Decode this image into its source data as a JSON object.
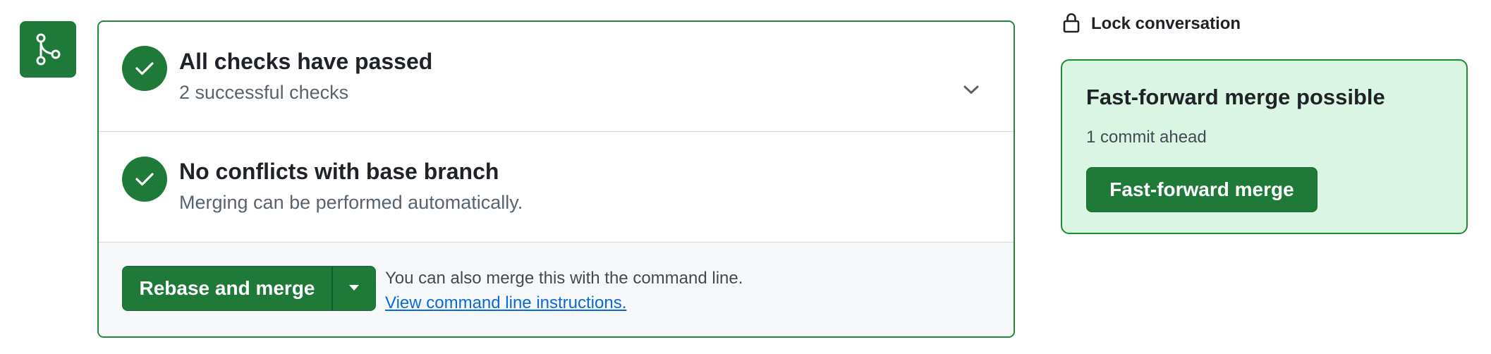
{
  "colors": {
    "success_green": "#1f7a3a",
    "border_green": "#1f883d",
    "light_green_bg": "#daf5e3",
    "link_blue": "#0969da",
    "muted_text": "#59636e"
  },
  "icons": {
    "badge": "git-merge-icon",
    "check": "check-icon",
    "chevron": "chevron-down-icon",
    "caret": "triangle-down-icon",
    "lock": "lock-icon"
  },
  "merge_box": {
    "checks": {
      "title": "All checks have passed",
      "subtitle": "2 successful checks"
    },
    "conflicts": {
      "title": "No conflicts with base branch",
      "subtitle": "Merging can be performed automatically."
    },
    "actions": {
      "merge_button_label": "Rebase and merge",
      "command_line_text": "You can also merge this with the command line.",
      "command_line_link": "View command line instructions."
    }
  },
  "sidebar": {
    "lock_label": "Lock conversation",
    "fast_forward": {
      "title": "Fast-forward merge possible",
      "subtitle": "1 commit ahead",
      "button_label": "Fast-forward merge"
    }
  }
}
